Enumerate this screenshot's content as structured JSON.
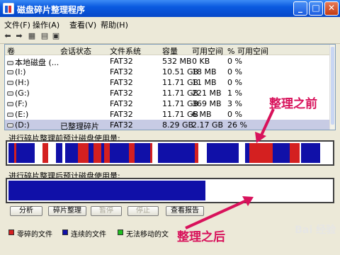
{
  "window": {
    "title": "磁盘碎片整理程序"
  },
  "menu": [
    "文件(F)",
    "操作(A)",
    "查看(V)",
    "帮助(H)"
  ],
  "columns": [
    "卷",
    "会话状态",
    "文件系统",
    "容量",
    "可用空间",
    "% 可用空间"
  ],
  "rows": [
    {
      "vol": "本地磁盘 (...",
      "status": "",
      "fs": "FAT32",
      "cap": "532 MB",
      "free": "0 KB",
      "pct": "0 %"
    },
    {
      "vol": "(I:)",
      "status": "",
      "fs": "FAT32",
      "cap": "10.51 GB",
      "free": "18 MB",
      "pct": "0 %"
    },
    {
      "vol": "(H:)",
      "status": "",
      "fs": "FAT32",
      "cap": "11.71 GB",
      "free": "11 MB",
      "pct": "0 %"
    },
    {
      "vol": "(G:)",
      "status": "",
      "fs": "FAT32",
      "cap": "11.71 GB",
      "free": "221 MB",
      "pct": "1 %"
    },
    {
      "vol": "(F:)",
      "status": "",
      "fs": "FAT32",
      "cap": "11.71 GB",
      "free": "369 MB",
      "pct": "3 %"
    },
    {
      "vol": "(E:)",
      "status": "",
      "fs": "FAT32",
      "cap": "11.71 GB",
      "free": "6 MB",
      "pct": "0 %"
    },
    {
      "vol": "(D:)",
      "status": "已整理碎片",
      "fs": "FAT32",
      "cap": "8.29 GB",
      "free": "2.17 GB",
      "pct": "26 %"
    }
  ],
  "labels": {
    "before": "进行碎片整理前预计磁盘使用量:",
    "after": "进行碎片整理后预计磁盘使用量:"
  },
  "buttons": {
    "analyze": "分析",
    "defrag": "碎片整理",
    "pause": "暂停",
    "stop": "停止",
    "report": "查看报告"
  },
  "legend": [
    {
      "label": "零碎的文件",
      "color": "#d42020"
    },
    {
      "label": "连续的文件",
      "color": "#1010a8"
    },
    {
      "label": "无法移动的文",
      "color": "#20c020"
    }
  ],
  "after_fill": 0.61,
  "annotations": {
    "before": "整理之前",
    "after": "整理之后"
  },
  "watermark": "Bai 经验",
  "colors": {
    "accent": "#d8125b",
    "fragmented": "#d42020",
    "contiguous": "#1010a8"
  }
}
